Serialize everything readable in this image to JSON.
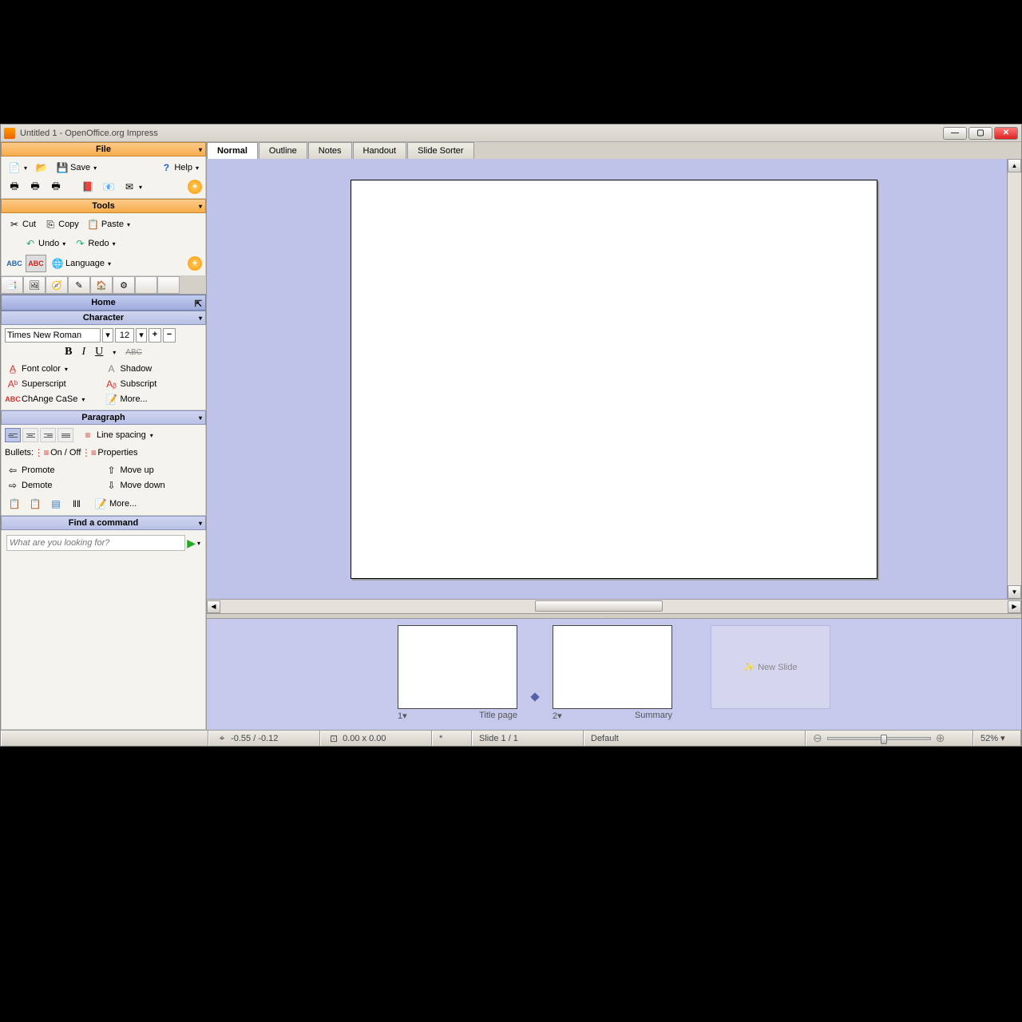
{
  "window": {
    "title": "Untitled 1 - OpenOffice.org Impress"
  },
  "sidebar": {
    "file": {
      "header": "File",
      "save": "Save",
      "help": "Help"
    },
    "tools": {
      "header": "Tools",
      "cut": "Cut",
      "copy": "Copy",
      "paste": "Paste",
      "undo": "Undo",
      "redo": "Redo",
      "language": "Language"
    },
    "home_tab": "Home",
    "character": {
      "header": "Character",
      "font": "Times New Roman",
      "size": "12",
      "fontcolor": "Font color",
      "shadow": "Shadow",
      "superscript": "Superscript",
      "subscript": "Subscript",
      "changecase": "ChAnge CaSe",
      "more": "More..."
    },
    "paragraph": {
      "header": "Paragraph",
      "linespacing": "Line spacing",
      "bullets_lbl": "Bullets:",
      "onoff": "On / Off",
      "properties": "Properties",
      "promote": "Promote",
      "demote": "Demote",
      "moveup": "Move up",
      "movedown": "Move down",
      "more": "More..."
    },
    "find": {
      "header": "Find a command",
      "placeholder": "What are you looking for?"
    }
  },
  "viewtabs": [
    "Normal",
    "Outline",
    "Notes",
    "Handout",
    "Slide Sorter"
  ],
  "thumbs": {
    "t1_num": "1",
    "t1_name": "Title page",
    "t2_num": "2",
    "t2_name": "Summary",
    "new": "New Slide"
  },
  "status": {
    "pos": "-0.55 / -0.12",
    "size": "0.00 x 0.00",
    "slide": "Slide 1 / 1",
    "style": "Default",
    "zoom": "52%"
  }
}
